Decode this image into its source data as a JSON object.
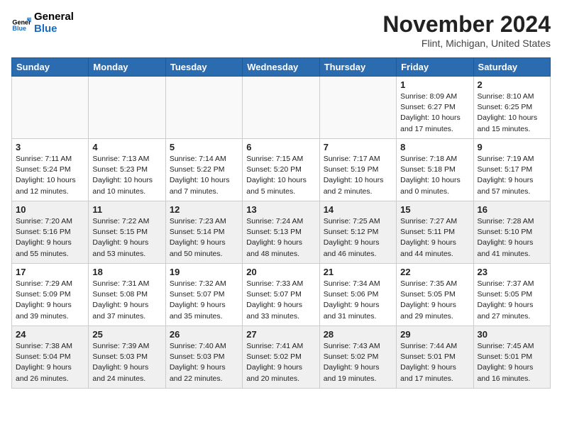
{
  "header": {
    "logo_line1": "General",
    "logo_line2": "Blue",
    "month": "November 2024",
    "location": "Flint, Michigan, United States"
  },
  "days_of_week": [
    "Sunday",
    "Monday",
    "Tuesday",
    "Wednesday",
    "Thursday",
    "Friday",
    "Saturday"
  ],
  "weeks": [
    [
      {
        "day": "",
        "info": ""
      },
      {
        "day": "",
        "info": ""
      },
      {
        "day": "",
        "info": ""
      },
      {
        "day": "",
        "info": ""
      },
      {
        "day": "",
        "info": ""
      },
      {
        "day": "1",
        "info": "Sunrise: 8:09 AM\nSunset: 6:27 PM\nDaylight: 10 hours and 17 minutes."
      },
      {
        "day": "2",
        "info": "Sunrise: 8:10 AM\nSunset: 6:25 PM\nDaylight: 10 hours and 15 minutes."
      }
    ],
    [
      {
        "day": "3",
        "info": "Sunrise: 7:11 AM\nSunset: 5:24 PM\nDaylight: 10 hours and 12 minutes."
      },
      {
        "day": "4",
        "info": "Sunrise: 7:13 AM\nSunset: 5:23 PM\nDaylight: 10 hours and 10 minutes."
      },
      {
        "day": "5",
        "info": "Sunrise: 7:14 AM\nSunset: 5:22 PM\nDaylight: 10 hours and 7 minutes."
      },
      {
        "day": "6",
        "info": "Sunrise: 7:15 AM\nSunset: 5:20 PM\nDaylight: 10 hours and 5 minutes."
      },
      {
        "day": "7",
        "info": "Sunrise: 7:17 AM\nSunset: 5:19 PM\nDaylight: 10 hours and 2 minutes."
      },
      {
        "day": "8",
        "info": "Sunrise: 7:18 AM\nSunset: 5:18 PM\nDaylight: 10 hours and 0 minutes."
      },
      {
        "day": "9",
        "info": "Sunrise: 7:19 AM\nSunset: 5:17 PM\nDaylight: 9 hours and 57 minutes."
      }
    ],
    [
      {
        "day": "10",
        "info": "Sunrise: 7:20 AM\nSunset: 5:16 PM\nDaylight: 9 hours and 55 minutes."
      },
      {
        "day": "11",
        "info": "Sunrise: 7:22 AM\nSunset: 5:15 PM\nDaylight: 9 hours and 53 minutes."
      },
      {
        "day": "12",
        "info": "Sunrise: 7:23 AM\nSunset: 5:14 PM\nDaylight: 9 hours and 50 minutes."
      },
      {
        "day": "13",
        "info": "Sunrise: 7:24 AM\nSunset: 5:13 PM\nDaylight: 9 hours and 48 minutes."
      },
      {
        "day": "14",
        "info": "Sunrise: 7:25 AM\nSunset: 5:12 PM\nDaylight: 9 hours and 46 minutes."
      },
      {
        "day": "15",
        "info": "Sunrise: 7:27 AM\nSunset: 5:11 PM\nDaylight: 9 hours and 44 minutes."
      },
      {
        "day": "16",
        "info": "Sunrise: 7:28 AM\nSunset: 5:10 PM\nDaylight: 9 hours and 41 minutes."
      }
    ],
    [
      {
        "day": "17",
        "info": "Sunrise: 7:29 AM\nSunset: 5:09 PM\nDaylight: 9 hours and 39 minutes."
      },
      {
        "day": "18",
        "info": "Sunrise: 7:31 AM\nSunset: 5:08 PM\nDaylight: 9 hours and 37 minutes."
      },
      {
        "day": "19",
        "info": "Sunrise: 7:32 AM\nSunset: 5:07 PM\nDaylight: 9 hours and 35 minutes."
      },
      {
        "day": "20",
        "info": "Sunrise: 7:33 AM\nSunset: 5:07 PM\nDaylight: 9 hours and 33 minutes."
      },
      {
        "day": "21",
        "info": "Sunrise: 7:34 AM\nSunset: 5:06 PM\nDaylight: 9 hours and 31 minutes."
      },
      {
        "day": "22",
        "info": "Sunrise: 7:35 AM\nSunset: 5:05 PM\nDaylight: 9 hours and 29 minutes."
      },
      {
        "day": "23",
        "info": "Sunrise: 7:37 AM\nSunset: 5:05 PM\nDaylight: 9 hours and 27 minutes."
      }
    ],
    [
      {
        "day": "24",
        "info": "Sunrise: 7:38 AM\nSunset: 5:04 PM\nDaylight: 9 hours and 26 minutes."
      },
      {
        "day": "25",
        "info": "Sunrise: 7:39 AM\nSunset: 5:03 PM\nDaylight: 9 hours and 24 minutes."
      },
      {
        "day": "26",
        "info": "Sunrise: 7:40 AM\nSunset: 5:03 PM\nDaylight: 9 hours and 22 minutes."
      },
      {
        "day": "27",
        "info": "Sunrise: 7:41 AM\nSunset: 5:02 PM\nDaylight: 9 hours and 20 minutes."
      },
      {
        "day": "28",
        "info": "Sunrise: 7:43 AM\nSunset: 5:02 PM\nDaylight: 9 hours and 19 minutes."
      },
      {
        "day": "29",
        "info": "Sunrise: 7:44 AM\nSunset: 5:01 PM\nDaylight: 9 hours and 17 minutes."
      },
      {
        "day": "30",
        "info": "Sunrise: 7:45 AM\nSunset: 5:01 PM\nDaylight: 9 hours and 16 minutes."
      }
    ]
  ]
}
